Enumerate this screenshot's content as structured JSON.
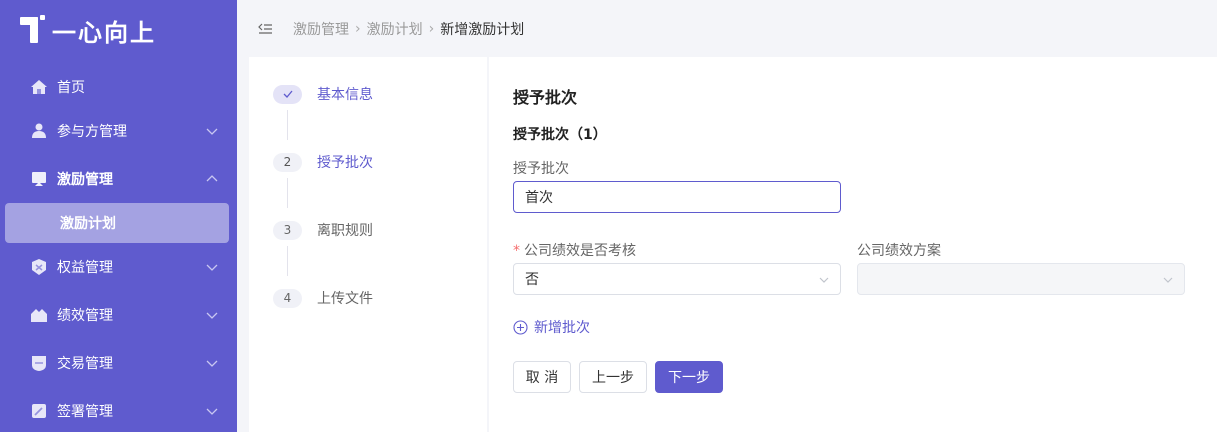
{
  "app": {
    "name": "一心向上"
  },
  "sidebar": {
    "items": [
      {
        "label": "首页",
        "icon": "home-icon",
        "expanded": false
      },
      {
        "label": "参与方管理",
        "icon": "participant-icon",
        "expanded": false
      },
      {
        "label": "激励管理",
        "icon": "incentive-icon",
        "expanded": true
      },
      {
        "label": "权益管理",
        "icon": "equity-icon",
        "expanded": false
      },
      {
        "label": "绩效管理",
        "icon": "performance-icon",
        "expanded": false
      },
      {
        "label": "交易管理",
        "icon": "trade-icon",
        "expanded": false
      },
      {
        "label": "签署管理",
        "icon": "sign-icon",
        "expanded": false
      }
    ],
    "active_sub": "激励计划"
  },
  "breadcrumb": [
    "激励管理",
    "激励计划",
    "新增激励计划"
  ],
  "steps": [
    {
      "index": "1",
      "label": "基本信息",
      "status": "done"
    },
    {
      "index": "2",
      "label": "授予批次",
      "status": "active"
    },
    {
      "index": "3",
      "label": "离职规则",
      "status": "pending"
    },
    {
      "index": "4",
      "label": "上传文件",
      "status": "pending"
    }
  ],
  "form": {
    "section_title": "授予批次",
    "batch_title": "授予批次（1）",
    "batch_label": "授予批次",
    "batch_value": "首次",
    "assess_label": "公司绩效是否考核",
    "assess_value": "否",
    "plan_label": "公司绩效方案",
    "plan_value": "",
    "add_batch": "新增批次"
  },
  "buttons": {
    "cancel": "取 消",
    "prev": "上一步",
    "next": "下一步"
  },
  "colors": {
    "primary": "#5f5bce",
    "sidebar_active": "#a4a2e2",
    "required": "#f56c6c"
  }
}
